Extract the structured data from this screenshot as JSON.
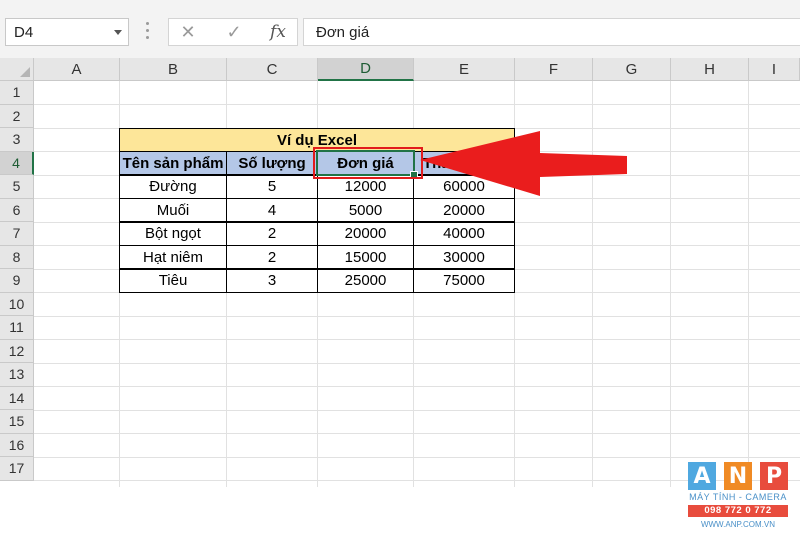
{
  "formula_bar": {
    "name_box": "D4",
    "cancel_symbol": "✕",
    "enter_symbol": "✓",
    "fx_label": "fx",
    "content": "Đơn giá"
  },
  "columns": [
    "A",
    "B",
    "C",
    "D",
    "E",
    "F",
    "G",
    "H",
    "I"
  ],
  "rows": [
    "1",
    "2",
    "3",
    "4",
    "5",
    "6",
    "7",
    "8",
    "9",
    "10",
    "11",
    "12",
    "13",
    "14",
    "15",
    "16",
    "17"
  ],
  "selected_cell": "D4",
  "table": {
    "title": "Ví dụ Excel",
    "headers": [
      "Tên sản phẩm",
      "Số lượng",
      "Đơn giá",
      "Thành tiền"
    ],
    "rows": [
      [
        "Đường",
        "5",
        "12000",
        "60000"
      ],
      [
        "Muối",
        "4",
        "5000",
        "20000"
      ],
      [
        "Bột ngọt",
        "2",
        "20000",
        "40000"
      ],
      [
        "Hạt niêm",
        "2",
        "15000",
        "30000"
      ],
      [
        "Tiêu",
        "3",
        "25000",
        "75000"
      ]
    ]
  },
  "watermark": {
    "letters": [
      "A",
      "N",
      "P"
    ],
    "line1": "MÁY TÍNH - CAMERA",
    "line2": "098 772 0 772",
    "line3": "WWW.ANP.COM.VN"
  },
  "colors": {
    "title_fill": "#fde699",
    "header_fill": "#b4c7e7",
    "selection": "#217346",
    "highlight_red": "#e21b1b"
  }
}
